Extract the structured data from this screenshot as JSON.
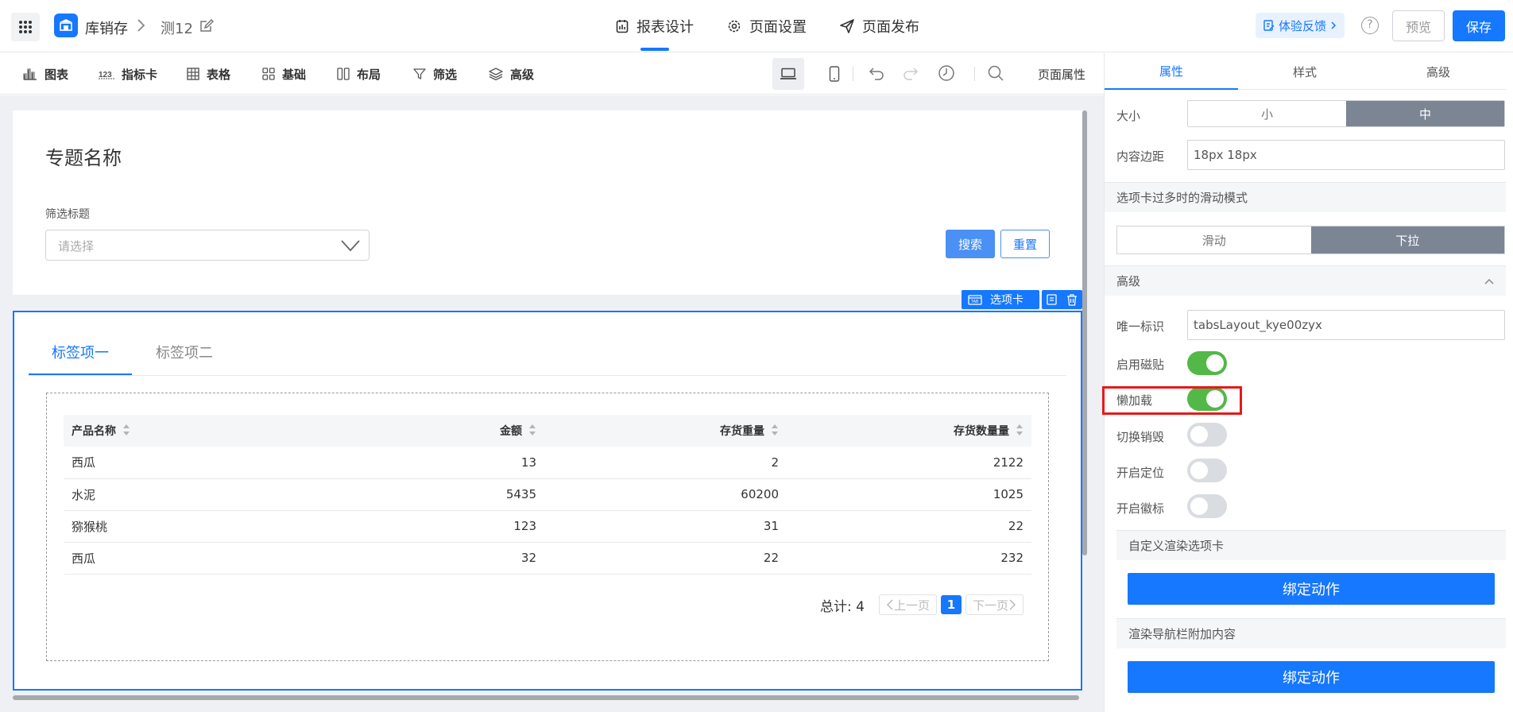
{
  "header": {
    "app_name": "库销存",
    "page_name": "测12",
    "tabs": [
      {
        "label": "报表设计",
        "icon": "report-icon"
      },
      {
        "label": "页面设置",
        "icon": "gear-icon"
      },
      {
        "label": "页面发布",
        "icon": "send-icon"
      }
    ],
    "feedback": "体验反馈",
    "help": "?",
    "preview": "预览",
    "save": "保存"
  },
  "toolbar": {
    "items": [
      {
        "label": "图表",
        "icon": "bar-chart-icon"
      },
      {
        "label": "指标卡",
        "icon": "number-icon"
      },
      {
        "label": "表格",
        "icon": "table-icon"
      },
      {
        "label": "基础",
        "icon": "widgets-icon"
      },
      {
        "label": "布局",
        "icon": "layout-icon"
      },
      {
        "label": "筛选",
        "icon": "filter-icon"
      },
      {
        "label": "高级",
        "icon": "layers-icon"
      }
    ],
    "page_props": "页面属性"
  },
  "canvas": {
    "topic_title": "专题名称",
    "filter_label": "筛选标题",
    "select_placeholder": "请选择",
    "search": "搜索",
    "reset": "重置",
    "tab_badge": "选项卡",
    "tabs": [
      "标签项一",
      "标签项二"
    ],
    "table": {
      "columns": [
        "产品名称",
        "金额",
        "存货重量",
        "存货数量量"
      ],
      "rows": [
        [
          "西瓜",
          "13",
          "2",
          "2122"
        ],
        [
          "水泥",
          "5435",
          "60200",
          "1025"
        ],
        [
          "猕猴桃",
          "123",
          "31",
          "22"
        ],
        [
          "西瓜",
          "32",
          "22",
          "232"
        ]
      ]
    },
    "pager": {
      "total": "总计: 4",
      "prev": "上一页",
      "page": "1",
      "next": "下一页"
    }
  },
  "panel": {
    "tabs": [
      "属性",
      "样式",
      "高级"
    ],
    "size_label": "大小",
    "size_options": [
      "小",
      "中"
    ],
    "size_selected": "中",
    "padding_label": "内容边距",
    "padding_value": "18px 18px",
    "scroll_mode_label": "选项卡过多时的滑动模式",
    "scroll_options": [
      "滑动",
      "下拉"
    ],
    "scroll_selected": "下拉",
    "advanced_label": "高级",
    "uid_label": "唯一标识",
    "uid_value": "tabsLayout_kye00zyx",
    "toggles": [
      {
        "label": "启用磁贴",
        "on": true
      },
      {
        "label": "懒加载",
        "on": true
      },
      {
        "label": "切换销毁",
        "on": false
      },
      {
        "label": "开启定位",
        "on": false
      },
      {
        "label": "开启徽标",
        "on": false
      }
    ],
    "custom_render_label": "自定义渲染选项卡",
    "bind_action": "绑定动作",
    "nav_extra_label": "渲染导航栏附加内容",
    "bind_action_2": "绑定动作"
  },
  "colors": {
    "primary": "#1677ff",
    "toggle_on": "#52b848",
    "toggle_off": "#d9dce1",
    "segment_selected": "#7c8594",
    "highlight": "#e81919"
  }
}
